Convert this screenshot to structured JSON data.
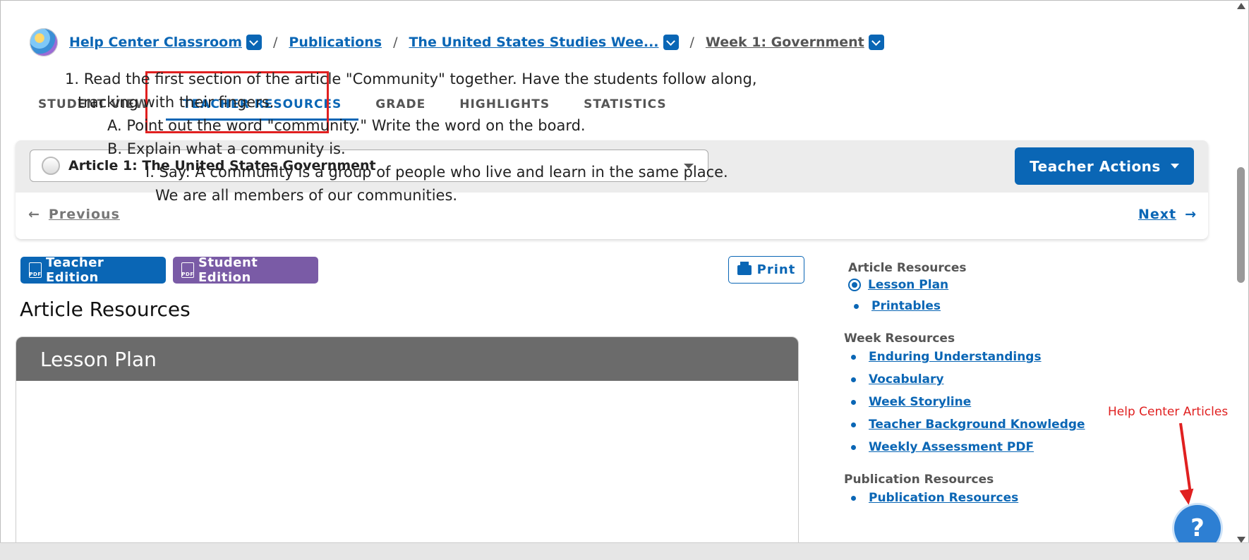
{
  "breadcrumb": {
    "items": [
      "Help Center Classroom",
      "Publications",
      "The United States Studies Wee...",
      "Week 1: Government"
    ],
    "separator": "/"
  },
  "tabs": [
    "STUDENT VIEW",
    "TEACHER RESOURCES",
    "GRADE",
    "HIGHLIGHTS",
    "STATISTICS"
  ],
  "article_select": {
    "value": "Article 1: The United States Government"
  },
  "teacher_actions": "Teacher Actions",
  "nav": {
    "previous": "Previous",
    "next": "Next"
  },
  "buttons": {
    "teacher_edition": "Teacher Edition",
    "student_edition": "Student Edition",
    "print": "Print",
    "pdf_label": "PDF"
  },
  "main": {
    "heading": "Article Resources",
    "card_title": "Lesson Plan",
    "lines": [
      "1. Read the first section of the article \"Community\" together. Have the students follow along,",
      "tracking with their fingers.",
      "A. Point out the word \"community.\" Write the word on the board.",
      "B. Explain what a community is.",
      "I. Say: A community is a group of people who live and learn in the same place.",
      "We are all members of our communities."
    ]
  },
  "sidebar": {
    "article_heading": "Article Resources",
    "article_links": [
      "Lesson Plan",
      "Printables"
    ],
    "week_heading": "Week Resources",
    "week_links": [
      "Enduring Understandings",
      "Vocabulary",
      "Week Storyline",
      "Teacher Background Knowledge",
      "Weekly Assessment PDF"
    ],
    "pub_heading": "Publication Resources",
    "pub_links": [
      "Publication Resources"
    ]
  },
  "help": {
    "label": "Help Center Articles",
    "button": "?"
  },
  "colors": {
    "primary": "#0a66b5",
    "student_edition": "#7a5ba6",
    "highlight": "#e02020",
    "card_header": "#6b6b6b"
  }
}
